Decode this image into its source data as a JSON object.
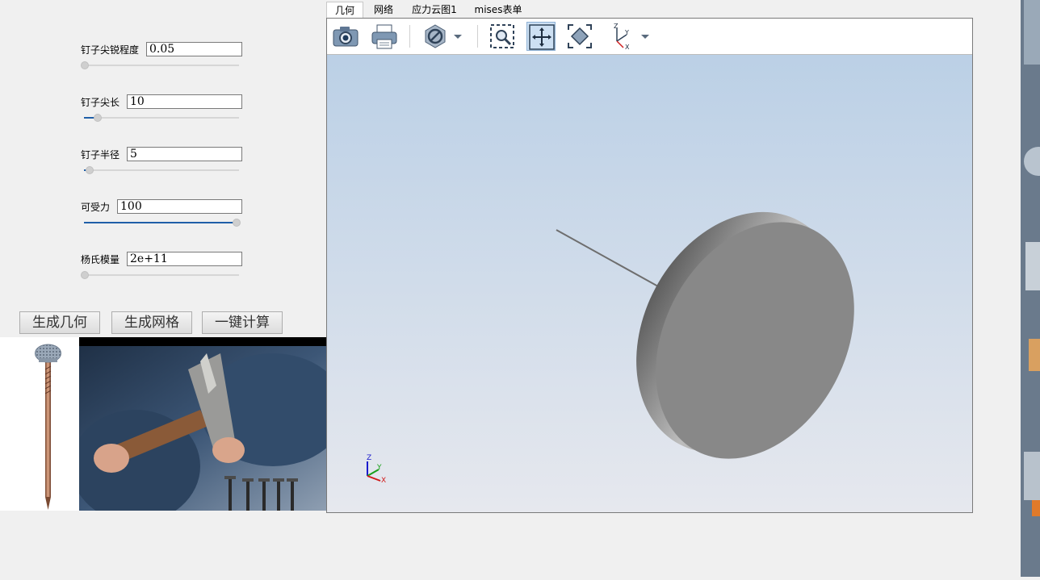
{
  "params": [
    {
      "label": "钉子尖锐程度",
      "value": "0.05",
      "level": 0.0
    },
    {
      "label": "钉子尖长",
      "value": "10",
      "level": 0.09
    },
    {
      "label": "钉子半径",
      "value": "5",
      "level": 0.04
    },
    {
      "label": "可受力",
      "value": "100",
      "level": 1.0
    },
    {
      "label": "杨氏模量",
      "value": "2e+11",
      "level": 0.0
    }
  ],
  "buttons": {
    "generate_geometry": "生成几何",
    "generate_mesh": "生成网格",
    "one_click_compute": "一键计算"
  },
  "tabs": [
    {
      "label": "几何",
      "active": true
    },
    {
      "label": "网络",
      "active": false
    },
    {
      "label": "应力云图1",
      "active": false
    },
    {
      "label": "mises表单",
      "active": false
    }
  ],
  "toolbar_icons": [
    "camera-icon",
    "printer-icon",
    "visibility-icon",
    "dropdown-arrow-icon",
    "zoom-box-icon",
    "pan-icon",
    "fit-view-icon",
    "axes-view-icon",
    "dropdown-arrow-icon"
  ],
  "axes": {
    "z": "Z",
    "y": "Y",
    "x": "X"
  },
  "colors": {
    "slider_fill": "#1f5fa8",
    "scene_top": "#bbd0e6",
    "scene_bottom": "#e6e8ee",
    "nail_head": "#888888"
  }
}
